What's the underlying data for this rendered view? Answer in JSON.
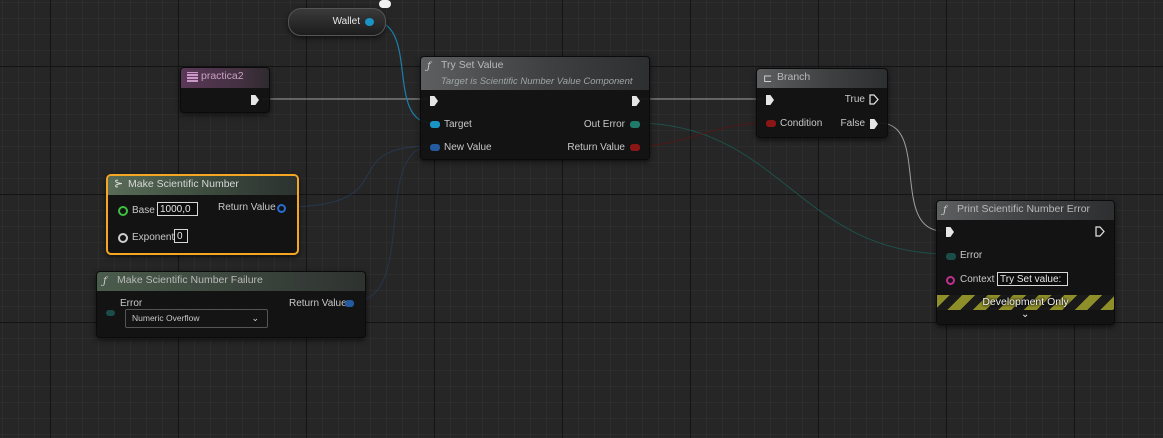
{
  "wallet": {
    "label": "Wallet"
  },
  "practica2": {
    "label": "practica2"
  },
  "try_set_value": {
    "icon": "function-icon",
    "title": "Try Set Value",
    "subtitle": "Target is Scientific Number Value Component",
    "pins": {
      "target": "Target",
      "new_value": "New Value",
      "out_error": "Out Error",
      "return_value": "Return Value"
    }
  },
  "branch": {
    "icon": "branch-icon",
    "title": "Branch",
    "pins": {
      "true": "True",
      "condition": "Condition",
      "false": "False"
    }
  },
  "make_sci": {
    "icon": "make-struct-icon",
    "title": "Make Scientific Number",
    "base_label": "Base",
    "base_value": "1000,0",
    "exponent_label": "Exponent",
    "exponent_value": "0",
    "return_label": "Return Value",
    "accent": "#f5a623"
  },
  "make_failure": {
    "icon": "function-icon",
    "title": "Make Scientific Number Failure",
    "error_label": "Error",
    "error_selected": "Numeric Overflow",
    "return_label": "Return Value"
  },
  "print_error": {
    "icon": "function-icon",
    "title": "Print Scientific Number Error",
    "error_label": "Error",
    "context_label": "Context",
    "context_value": "Try Set value:",
    "dev_only": "Development Only"
  }
}
